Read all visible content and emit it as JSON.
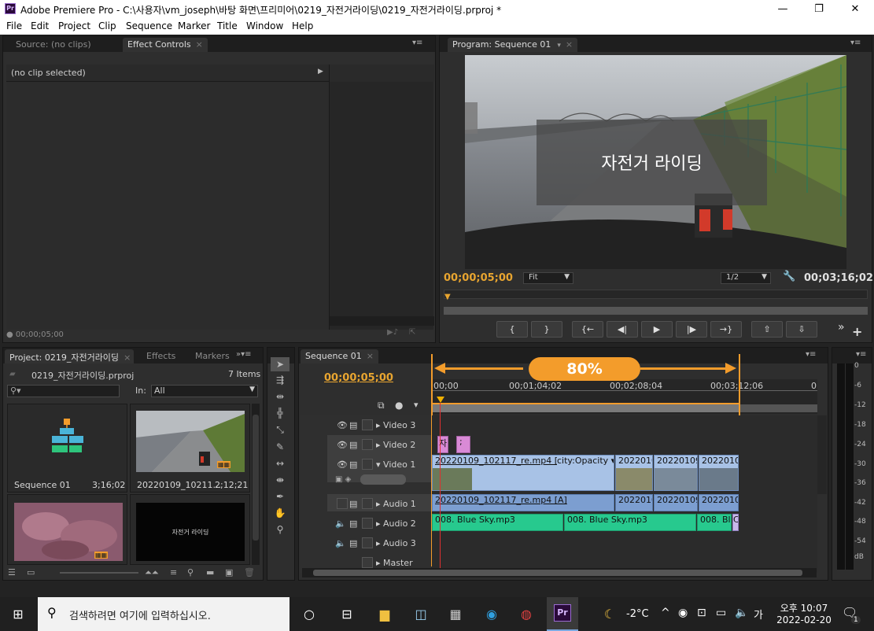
{
  "window": {
    "title": "Adobe Premiere Pro - C:\\사용자\\vm_joseph\\바탕 화면\\프리미어\\0219_자전거라이딩\\0219_자전거라이딩.prproj *",
    "app_icon": "Pr",
    "minimize": "—",
    "maximize": "❐",
    "close": "✕"
  },
  "menu": [
    "File",
    "Edit",
    "Project",
    "Clip",
    "Sequence",
    "Marker",
    "Title",
    "Window",
    "Help"
  ],
  "source_panel": {
    "tab_source": "Source: (no clips)",
    "tab_effect_controls": "Effect Controls",
    "close": "×",
    "no_clip": "(no clip selected)",
    "timecode": "00;00;05;00"
  },
  "program_panel": {
    "tab": "Program: Sequence 01",
    "title_overlay": "자전거 라이딩",
    "timecode_left": "00;00;05;00",
    "fit": "Fit",
    "resolution": "1/2",
    "timecode_right": "00;03;16;02",
    "buttons": [
      "{",
      "}",
      "{←",
      "◀|",
      "▶",
      "|▶",
      "→}",
      "⇧",
      "⇩"
    ],
    "more": "»",
    "add": "+"
  },
  "project_panel": {
    "tab_project": "Project: 0219_자전거라이딩",
    "tab_effects": "Effects",
    "tab_markers": "Markers",
    "file": "0219_자전거라이딩.prproj",
    "items_count": "7 Items",
    "in_label": "In:",
    "in_value": "All",
    "items": [
      {
        "name": "Sequence 01",
        "duration": "3;16;02"
      },
      {
        "name": "20220109_10211...",
        "duration": "2;12;21"
      },
      {
        "name": "",
        "duration": ""
      },
      {
        "name": "자전거 라이딩",
        "duration": ""
      }
    ]
  },
  "timeline": {
    "tab": "Sequence 01",
    "timecode": "00;00;05;00",
    "ruler": [
      "00;00",
      "00;01;04;02",
      "00;02;08;04",
      "00;03;12;06",
      "0"
    ],
    "zoom_label": "80%",
    "tracks": {
      "video3": "Video 3",
      "video2": "Video 2",
      "video1": "Video 1",
      "audio1": "Audio 1",
      "audio2": "Audio 2",
      "audio3": "Audio 3",
      "master": "Master"
    },
    "clips": {
      "v2_a": "자",
      "v2_b": ";",
      "v1_main": "20220109_102117_re.mp4 [V]",
      "v1_opacity": "city:Opacity ▾",
      "v1_c2": "2022010",
      "v1_c3": "20220109_",
      "v1_c4": "20220109",
      "a1_main": "20220109_102117_re.mp4 [A]",
      "a1_c2": "2022010",
      "a1_c3": "20220109_",
      "a1_c4": "20220109",
      "a2_c1": "008. Blue Sky.mp3",
      "a2_c2": "008. Blue Sky.mp3",
      "a2_c3": "008. Blu",
      "a2_c4": "C"
    }
  },
  "meter": {
    "labels": [
      "0",
      "-6",
      "-12",
      "-18",
      "-24",
      "-30",
      "-36",
      "-42",
      "-48",
      "-54",
      "dB"
    ]
  },
  "taskbar": {
    "search_placeholder": "검색하려면 여기에 입력하십시오.",
    "weather": "-2°C",
    "ime": "가",
    "time": "오후 10:07",
    "date": "2022-02-20",
    "notifications": "1"
  },
  "colors": {
    "accent_orange": "#f39c2b",
    "timecode_yellow": "#e8a530",
    "music_green": "#27c98e",
    "video_blue": "#a8c2e6"
  }
}
